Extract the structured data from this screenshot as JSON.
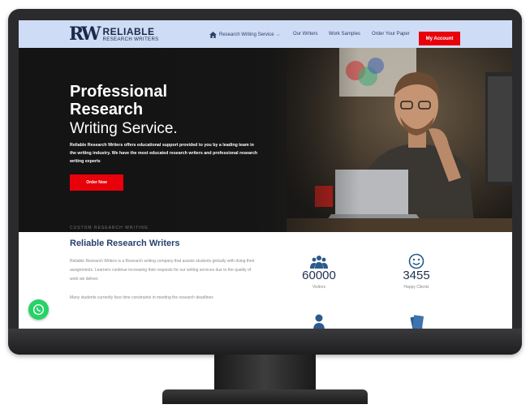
{
  "brand": {
    "mark": "RW",
    "name_top": "RELIABLE",
    "name_bottom": "RESEARCH WRITERS"
  },
  "nav": {
    "items": [
      {
        "label": "Research Writing Service",
        "has_dropdown": true,
        "icon": "home-icon"
      },
      {
        "label": "Our Writers"
      },
      {
        "label": "Work Samples"
      },
      {
        "label": "Order Your Paper"
      }
    ],
    "cta": "My Account"
  },
  "hero": {
    "title": "Professional Research",
    "subtitle": "Writing Service.",
    "description": "Reliable Research Writers offers educational support provided to you by a leading team in the writing industry. We have the most educated research writers and professional research writing experts",
    "button": "Order Now"
  },
  "about": {
    "eyebrow": "CUSTOM RESEARCH WRITING",
    "title": "Reliable Research Writers",
    "paragraph1": "Reliable Research Writers is a Research writing company that assists students globally with doing their assignments. Learners continue increasing their requests for our writing services due to the quality of work we deliver.",
    "paragraph2": "Many students currently face time constraints in meeting the research deadlines"
  },
  "stats": [
    {
      "icon": "group-icon",
      "value": "60000",
      "label": "Visitors"
    },
    {
      "icon": "smiley-icon",
      "value": "3455",
      "label": "Happy Clients"
    },
    {
      "icon": "person-icon",
      "value": "",
      "label": ""
    },
    {
      "icon": "document-icon",
      "value": "",
      "label": ""
    }
  ],
  "colors": {
    "header_bg": "#cfdcf5",
    "accent_red": "#e8000b",
    "navy": "#26406e",
    "icon_blue": "#2c5a8c",
    "whatsapp": "#25d366"
  },
  "widgets": {
    "whatsapp": "whatsapp-icon"
  }
}
